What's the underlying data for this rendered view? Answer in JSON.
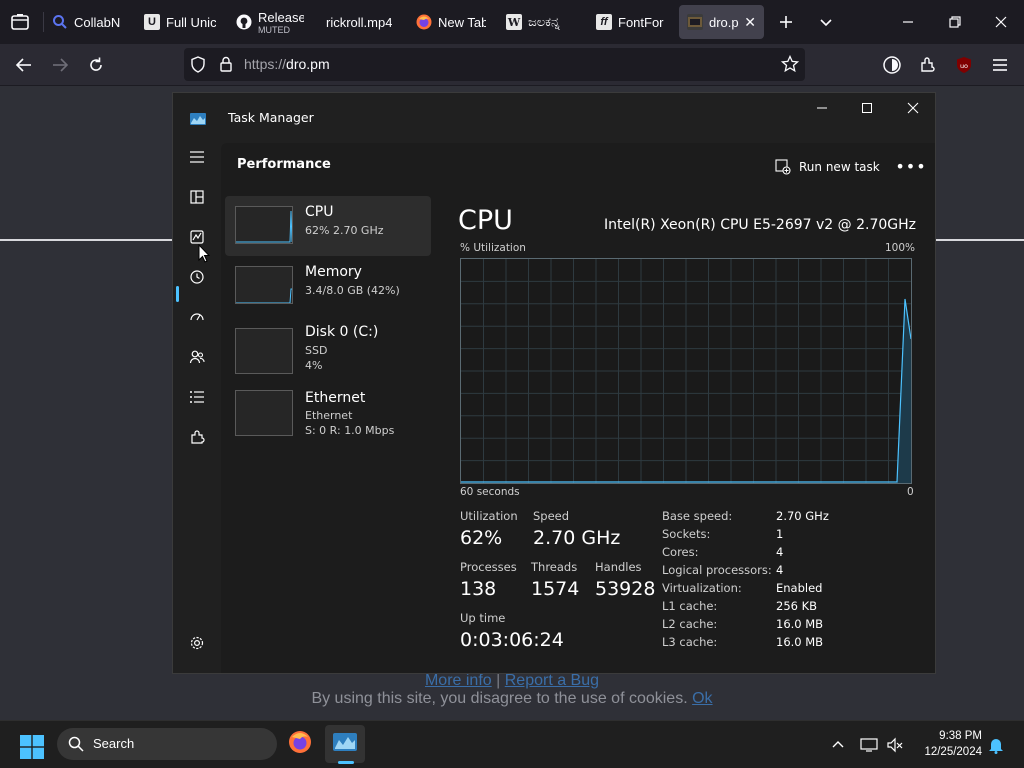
{
  "browser": {
    "tabs": [
      {
        "label": "CollabN",
        "icon": "collab-search-icon"
      },
      {
        "label": "Full Unic",
        "icon": "unicode-icon"
      },
      {
        "label": "Release",
        "sub": "MUTED",
        "icon": "github-icon"
      },
      {
        "label": "rickroll.mp4",
        "icon": "video-icon"
      },
      {
        "label": "New Tab",
        "icon": "firefox-icon"
      },
      {
        "label": "ಜಲಕನ್ನ",
        "icon": "wikipedia-icon"
      },
      {
        "label": "FontFor",
        "icon": "fontforge-icon"
      },
      {
        "label": "dro.p",
        "icon": "dro-icon",
        "active": true
      }
    ],
    "url": {
      "scheme": "https://",
      "host": "dro.pm"
    }
  },
  "page": {
    "links": {
      "more_info": "More info",
      "separator": "|",
      "report_bug": "Report a Bug"
    },
    "cookie": {
      "text": "By using this site, you disagree to the use of cookies.",
      "ok": "Ok"
    }
  },
  "task_manager": {
    "title": "Task Manager",
    "section": "Performance",
    "run_new_task": "Run new task",
    "resources": [
      {
        "name": "CPU",
        "sub1": "62%  2.70 GHz"
      },
      {
        "name": "Memory",
        "sub1": "3.4/8.0 GB (42%)"
      },
      {
        "name": "Disk 0 (C:)",
        "sub1": "SSD",
        "sub2": "4%"
      },
      {
        "name": "Ethernet",
        "sub1": "Ethernet",
        "sub2": "S: 0 R: 1.0 Mbps"
      }
    ],
    "detail": {
      "title": "CPU",
      "model": "Intel(R) Xeon(R) CPU E5-2697 v2 @ 2.70GHz",
      "graph_ylabel": "% Utilization",
      "graph_ymax": "100%",
      "graph_xlabel": "60 seconds",
      "graph_xmin": "0",
      "utilization_label": "Utilization",
      "utilization": "62%",
      "speed_label": "Speed",
      "speed": "2.70 GHz",
      "processes_label": "Processes",
      "processes": "138",
      "threads_label": "Threads",
      "threads": "1574",
      "handles_label": "Handles",
      "handles": "53928",
      "uptime_label": "Up time",
      "uptime": "0:03:06:24",
      "specs": [
        {
          "k": "Base speed:",
          "v": "2.70 GHz"
        },
        {
          "k": "Sockets:",
          "v": "1"
        },
        {
          "k": "Cores:",
          "v": "4"
        },
        {
          "k": "Logical processors:",
          "v": "4"
        },
        {
          "k": "Virtualization:",
          "v": "Enabled"
        },
        {
          "k": "L1 cache:",
          "v": "256 KB"
        },
        {
          "k": "L2 cache:",
          "v": "16.0 MB"
        },
        {
          "k": "L3 cache:",
          "v": "16.0 MB"
        }
      ]
    }
  },
  "taskbar": {
    "search": "Search",
    "time": "9:38 PM",
    "date": "12/25/2024"
  },
  "colors": {
    "accent": "#4cc2ff",
    "graph_line": "#4cc2ff"
  }
}
